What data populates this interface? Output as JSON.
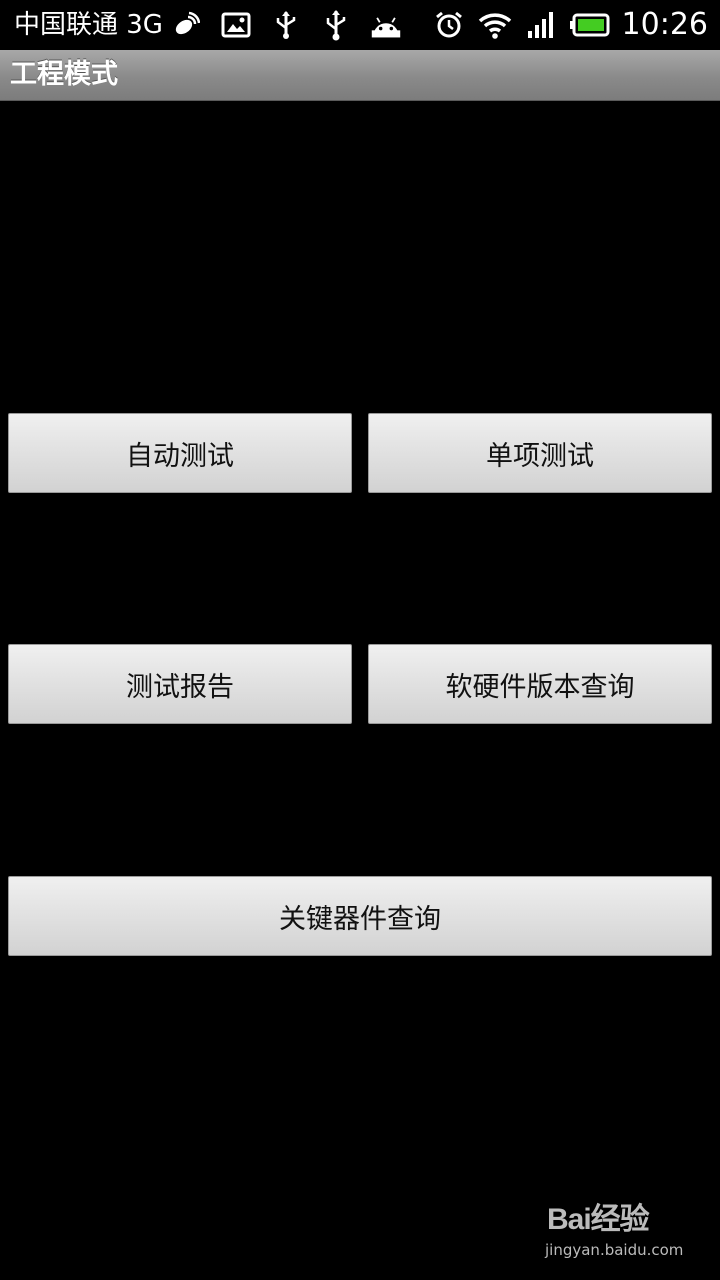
{
  "status_bar": {
    "carrier": "中国联通 3G",
    "time": "10:26",
    "icons_left": [
      "satellite-icon",
      "image-icon",
      "usb-icon",
      "usb-debug-icon",
      "android-icon"
    ],
    "icons_right": [
      "alarm-icon",
      "wifi-icon",
      "signal-icon",
      "battery-icon"
    ]
  },
  "title_bar": {
    "title": "工程模式"
  },
  "buttons": {
    "auto_test": "自动测试",
    "single_test": "单项测试",
    "test_report": "测试报告",
    "version_query": "软硬件版本查询",
    "key_component_query": "关键器件查询"
  },
  "watermark": {
    "logo": "Bai经验",
    "url": "jingyan.baidu.com"
  },
  "colors": {
    "background": "#000000",
    "title_bar": "#8a8a8a",
    "button": "#e2e2e2",
    "battery_fill": "#44cc22"
  }
}
